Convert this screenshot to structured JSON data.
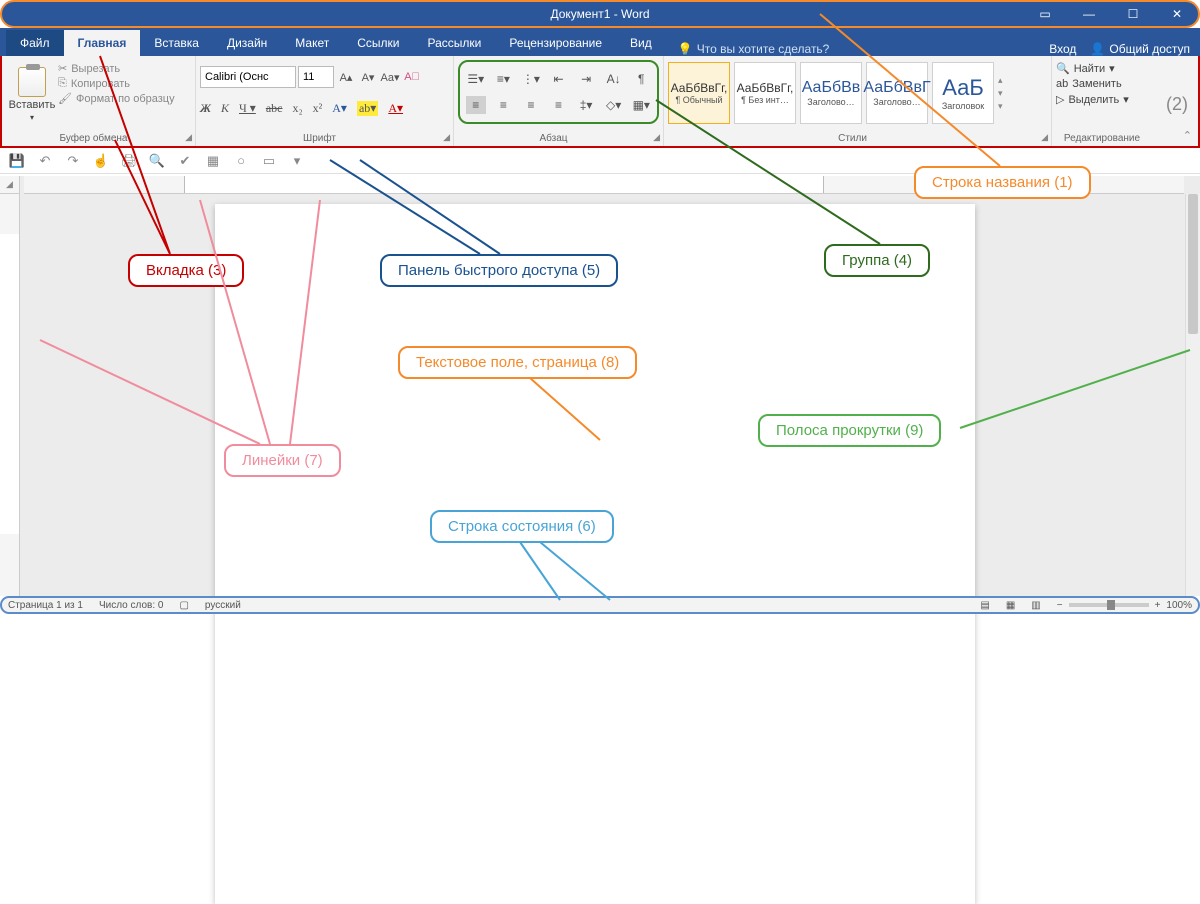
{
  "title": "Документ1 - Word",
  "tabs": {
    "file": "Файл",
    "home": "Главная",
    "insert": "Вставка",
    "design": "Дизайн",
    "layout": "Макет",
    "references": "Ссылки",
    "mailings": "Рассылки",
    "review": "Рецензирование",
    "view": "Вид"
  },
  "tellme": "Что вы хотите сделать?",
  "signin": "Вход",
  "share": "Общий доступ",
  "ribbon": {
    "clipboard": {
      "paste": "Вставить",
      "cut": "Вырезать",
      "copy": "Копировать",
      "format_painter": "Формат по образцу",
      "label": "Буфер обмена"
    },
    "font": {
      "name": "Calibri (Оснс",
      "size": "11",
      "label": "Шрифт"
    },
    "paragraph": {
      "label": "Абзац"
    },
    "styles": {
      "label": "Стили",
      "items": [
        {
          "sample": "АаБбВвГг,",
          "name": "¶ Обычный"
        },
        {
          "sample": "АаБбВвГг,",
          "name": "¶ Без инт…"
        },
        {
          "sample": "АаБбВв",
          "name": "Заголово…"
        },
        {
          "sample": "АаБбВвГ",
          "name": "Заголово…"
        },
        {
          "sample": "АаБ",
          "name": "Заголовок"
        }
      ]
    },
    "editing": {
      "find": "Найти",
      "replace": "Заменить",
      "select": "Выделить",
      "label": "Редактирование"
    }
  },
  "status": {
    "page": "Страница 1 из 1",
    "words": "Число слов: 0",
    "lang": "русский",
    "zoom": "100%"
  },
  "callouts": {
    "c1": "Строка названия (1)",
    "c2": "(2)",
    "c3": "Вкладка (3)",
    "c4": "Группа (4)",
    "c5": "Панель быстрого доступа (5)",
    "c6": "Строка состояния (6)",
    "c7": "Линейки (7)",
    "c8": "Текстовое поле, страница (8)",
    "c9": "Полоса прокрутки (9)"
  }
}
